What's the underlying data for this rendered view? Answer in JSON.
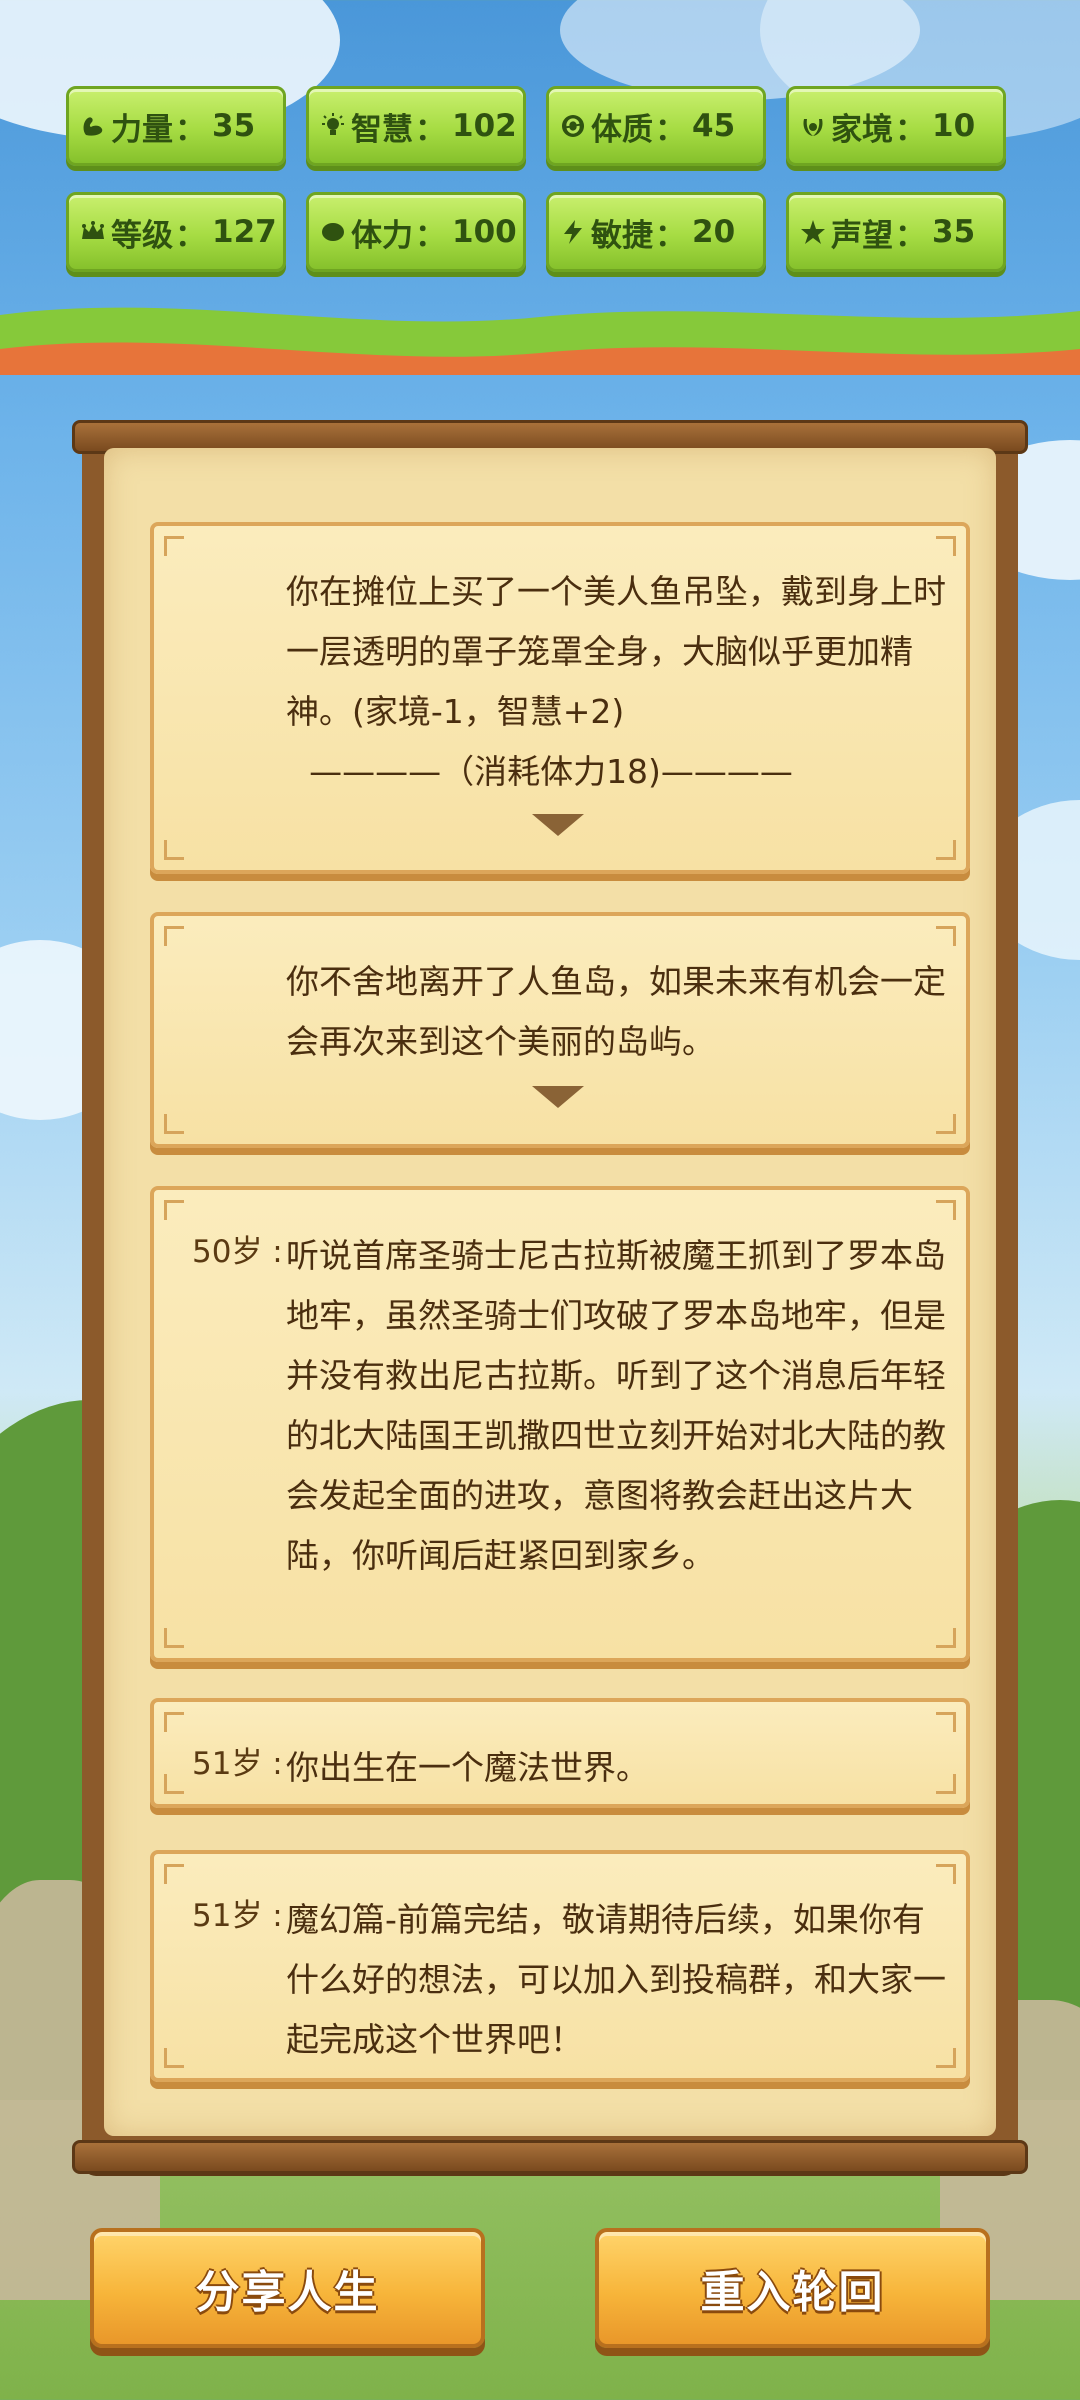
{
  "stats": [
    {
      "name": "力量",
      "value": "35",
      "icon": "muscle-icon"
    },
    {
      "name": "智慧",
      "value": "102",
      "icon": "lightbulb-icon"
    },
    {
      "name": "体质",
      "value": "45",
      "icon": "refresh-icon"
    },
    {
      "name": "家境",
      "value": "10",
      "icon": "laurel-icon"
    },
    {
      "name": "等级",
      "value": "127",
      "icon": "crown-icon"
    },
    {
      "name": "体力",
      "value": "100",
      "icon": "heart-icon"
    },
    {
      "name": "敏捷",
      "value": "20",
      "icon": "lightning-icon"
    },
    {
      "name": "声望",
      "value": "35",
      "icon": "star-icon"
    }
  ],
  "stat_separator": "：",
  "log": [
    {
      "age": "",
      "text": "你在摊位上买了一个美人鱼吊坠，戴到身上时一层透明的罩子笼罩全身，大脑似乎更加精神。(家境-1，智慧+2)",
      "sub": "————（消耗体力18)————",
      "has_arrow": true
    },
    {
      "age": "",
      "text": "你不舍地离开了人鱼岛，如果未来有机会一定会再次来到这个美丽的岛屿。",
      "sub": "",
      "has_arrow": true
    },
    {
      "age": "50岁 :",
      "text": "听说首席圣骑士尼古拉斯被魔王抓到了罗本岛地牢，虽然圣骑士们攻破了罗本岛地牢，但是并没有救出尼古拉斯。听到了这个消息后年轻的北大陆国王凯撒四世立刻开始对北大陆的教会发起全面的进攻，意图将教会赶出这片大陆，你听闻后赶紧回到家乡。",
      "sub": "",
      "has_arrow": false
    },
    {
      "age": "51岁 :",
      "text": "你出生在一个魔法世界。",
      "sub": "",
      "has_arrow": false
    },
    {
      "age": "51岁 :",
      "text": "魔幻篇-前篇完结，敬请期待后续，如果你有什么好的想法，可以加入到投稿群，和大家一起完成这个世界吧！",
      "sub": "",
      "has_arrow": false
    }
  ],
  "buttons": {
    "share": "分享人生",
    "restart": "重入轮回"
  },
  "colors": {
    "stat_green": "#a6dc43",
    "card_bg": "#f7e1a4",
    "button_orange": "#f7b53a",
    "frame_brown": "#8c5a2b"
  }
}
